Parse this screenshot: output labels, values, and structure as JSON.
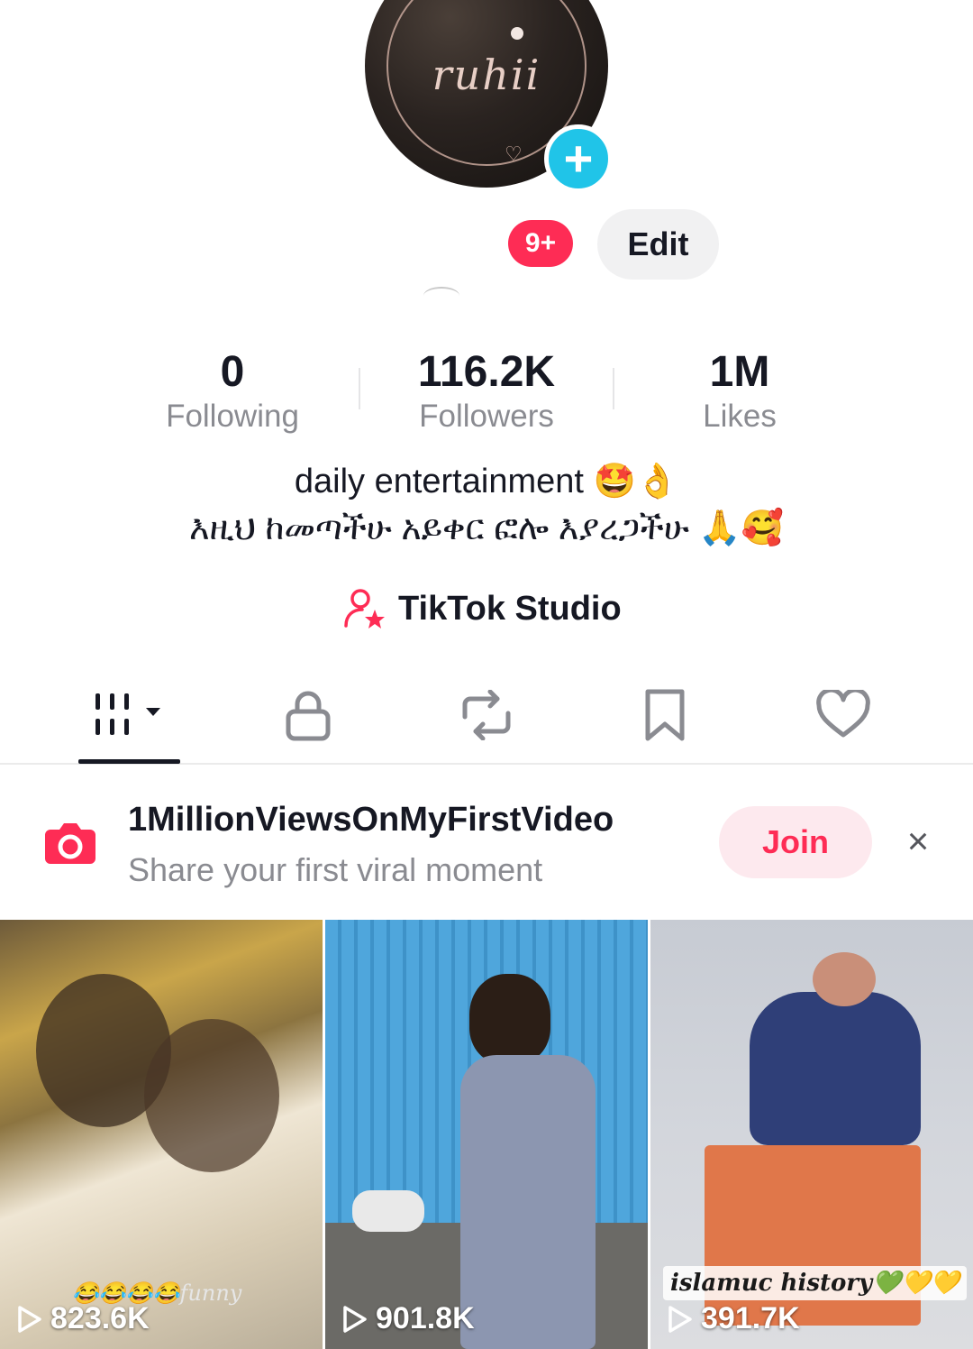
{
  "profile": {
    "avatar_text": "ruhii",
    "notification_badge": "9+",
    "edit_label": "Edit"
  },
  "stats": [
    {
      "value": "0",
      "label": "Following"
    },
    {
      "value": "116.2K",
      "label": "Followers"
    },
    {
      "value": "1M",
      "label": "Likes"
    }
  ],
  "bio": {
    "line1": "daily entertainment 🤩👌",
    "line2": "እዚህ ከመጣችሁ አይቀር ፎሎ እያረጋችሁ 🙏🥰"
  },
  "studio": {
    "label": "TikTok Studio"
  },
  "tabs": {
    "items": [
      "videos-grid-icon",
      "lock-icon",
      "repost-icon",
      "bookmark-icon",
      "heart-icon"
    ],
    "active": 0
  },
  "challenge": {
    "title": "1MillionViewsOnMyFirstVideo",
    "subtitle": "Share your first viral moment",
    "join_label": "Join",
    "close_label": "×"
  },
  "videos": [
    {
      "views": "823.6K",
      "overlay": "😂😂😂😂funny"
    },
    {
      "views": "901.8K"
    },
    {
      "views": "391.7K",
      "caption": "islamuc history💚💛💛"
    }
  ],
  "colors": {
    "accent": "#fe2c55",
    "add_button": "#20c4e8",
    "text_primary": "#161823",
    "text_secondary": "#8a8b91"
  }
}
